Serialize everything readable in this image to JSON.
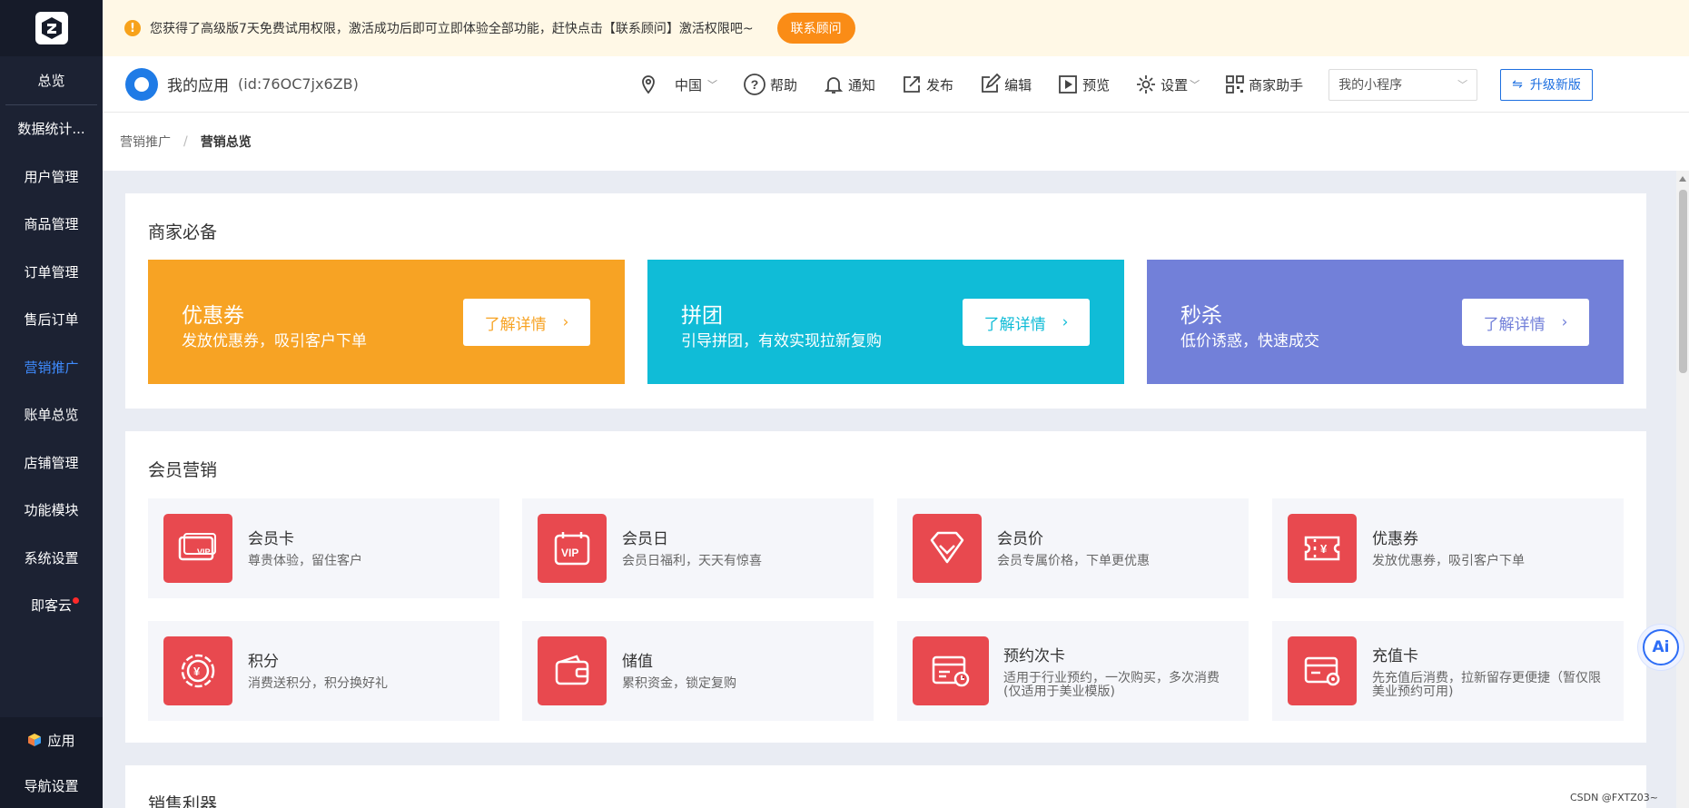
{
  "sidebar": {
    "items": [
      {
        "label": "总览",
        "active": false
      },
      {
        "label": "数据统计...",
        "active": false
      },
      {
        "label": "用户管理",
        "active": false
      },
      {
        "label": "商品管理",
        "active": false
      },
      {
        "label": "订单管理",
        "active": false
      },
      {
        "label": "售后订单",
        "active": false
      },
      {
        "label": "营销推广",
        "active": true
      },
      {
        "label": "账单总览",
        "active": false
      },
      {
        "label": "店铺管理",
        "active": false
      },
      {
        "label": "功能模块",
        "active": false
      },
      {
        "label": "系统设置",
        "active": false
      },
      {
        "label": "即客云",
        "active": false,
        "badge": true
      }
    ],
    "bottom": {
      "apps_label": "应用",
      "nav_label": "导航设置"
    }
  },
  "notice": {
    "text": "您获得了高级版7天免费试用权限，激活成功后即可立即体验全部功能，赶快点击【联系顾问】激活权限吧~",
    "button": "联系顾问"
  },
  "header": {
    "app_name": "我的应用",
    "app_id": "(id:76OC7jx6ZB)",
    "region": "中国",
    "help": "帮助",
    "notify": "通知",
    "publish": "发布",
    "edit": "编辑",
    "preview": "预览",
    "settings": "设置",
    "merchant_helper": "商家助手",
    "select_value": "我的小程序",
    "upgrade": "升级新版"
  },
  "breadcrumb": {
    "parent": "营销推广",
    "separator": "/",
    "current": "营销总览"
  },
  "sections": {
    "essentials": {
      "title": "商家必备",
      "promos": [
        {
          "title": "优惠券",
          "subtitle": "发放优惠券，吸引客户下单",
          "button": "了解详情",
          "color": "#f7a324"
        },
        {
          "title": "拼团",
          "subtitle": "引导拼团，有效实现拉新复购",
          "button": "了解详情",
          "color": "#10bcd7"
        },
        {
          "title": "秒杀",
          "subtitle": "低价诱惑，快速成交",
          "button": "了解详情",
          "color": "#7280d9"
        }
      ]
    },
    "member": {
      "title": "会员营销",
      "cards": [
        {
          "title": "会员卡",
          "desc": "尊贵体验，留住客户",
          "icon": "member-card-icon"
        },
        {
          "title": "会员日",
          "desc": "会员日福利，天天有惊喜",
          "icon": "member-day-icon"
        },
        {
          "title": "会员价",
          "desc": "会员专属价格，下单更优惠",
          "icon": "member-price-icon"
        },
        {
          "title": "优惠券",
          "desc": "发放优惠券，吸引客户下单",
          "icon": "coupon-icon"
        },
        {
          "title": "积分",
          "desc": "消费送积分，积分换好礼",
          "icon": "points-icon"
        },
        {
          "title": "储值",
          "desc": "累积资金，锁定复购",
          "icon": "stored-value-icon"
        },
        {
          "title": "预约次卡",
          "desc": "适用于行业预约，一次购买，多次消费(仅适用于美业模版)",
          "icon": "appointment-card-icon"
        },
        {
          "title": "充值卡",
          "desc": "先充值后消费，拉新留存更便捷（暂仅限美业预约可用)",
          "icon": "recharge-card-icon"
        }
      ]
    },
    "sales": {
      "title": "销售利器"
    }
  },
  "ai": {
    "label": "Ai"
  },
  "watermark": "CSDN @FXTZ03~",
  "colors": {
    "accent": "#1d6fe0",
    "card_icon": "#e8494f",
    "sidebar_bg": "#1c2233",
    "notice_btn": "#fa8c16"
  }
}
